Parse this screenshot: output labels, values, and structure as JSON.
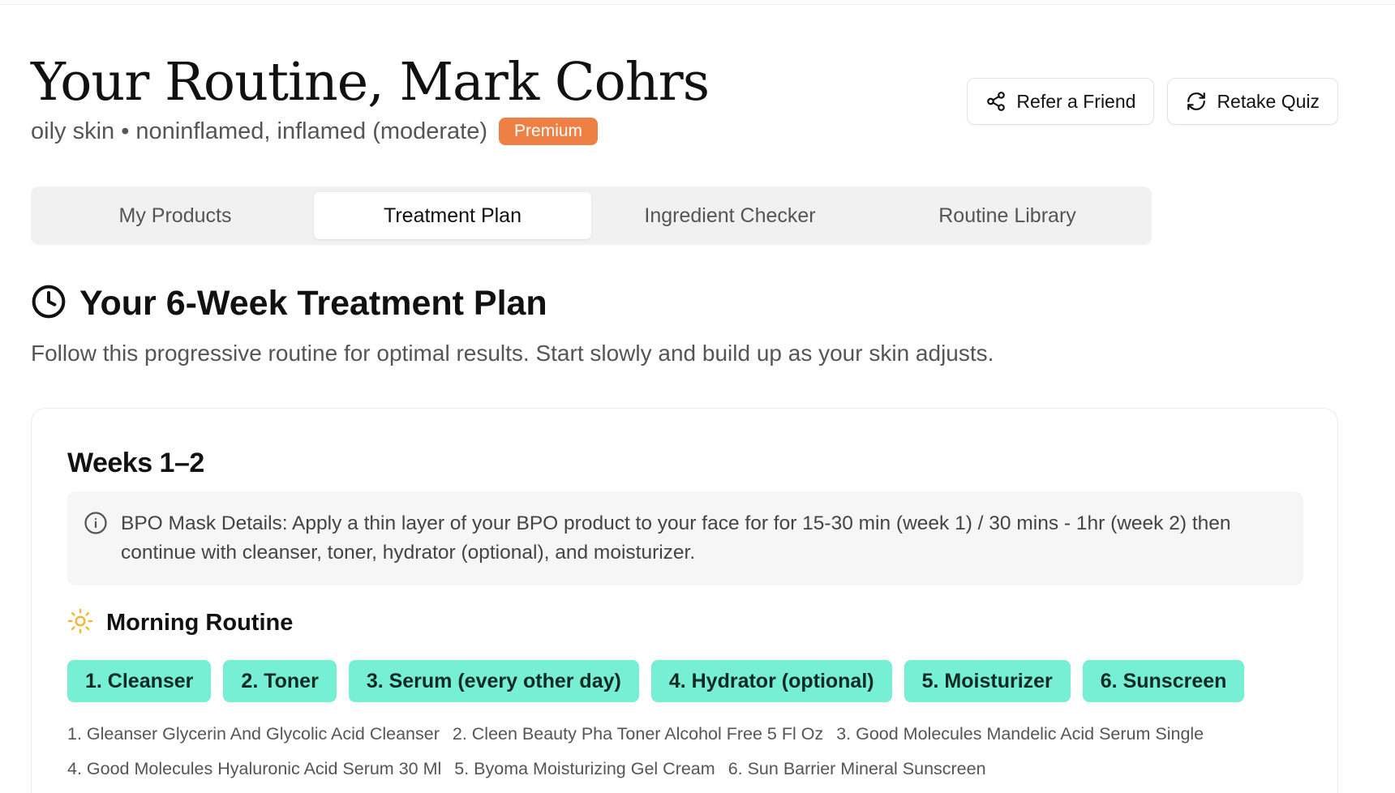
{
  "header": {
    "title": "Your Routine, Mark Cohrs",
    "subtitle": "oily skin • noninflamed, inflamed (moderate)",
    "badge": "Premium",
    "actions": {
      "refer_label": "Refer a Friend",
      "refer_icon": "share-icon",
      "retake_label": "Retake Quiz",
      "retake_icon": "refresh-icon"
    }
  },
  "tabs": [
    {
      "label": "My Products",
      "active": false
    },
    {
      "label": "Treatment Plan",
      "active": true
    },
    {
      "label": "Ingredient Checker",
      "active": false
    },
    {
      "label": "Routine Library",
      "active": false
    }
  ],
  "section": {
    "icon": "clock-icon",
    "title": "Your 6-Week Treatment Plan",
    "description": "Follow this progressive routine for optimal results. Start slowly and build up as your skin adjusts."
  },
  "plan_card": {
    "title": "Weeks 1–2",
    "notice_icon": "info-icon",
    "notice": "BPO Mask Details: Apply a thin layer of your BPO product to your face for for 15-30 min (week 1) / 30 mins - 1hr (week 2) then continue with cleanser, toner, hydrator (optional), and moisturizer.",
    "morning": {
      "icon": "sun-icon",
      "title": "Morning Routine",
      "steps": [
        "1. Cleanser",
        "2. Toner",
        "3. Serum (every other day)",
        "4. Hydrator (optional)",
        "5. Moisturizer",
        "6. Sunscreen"
      ],
      "products": [
        "1. Gleanser Glycerin And Glycolic Acid Cleanser",
        "2. Cleen Beauty Pha Toner Alcohol Free 5 Fl Oz",
        "3. Good Molecules Mandelic Acid Serum Single",
        "4. Good Molecules Hyaluronic Acid Serum 30 Ml",
        "5. Byoma Moisturizing Gel Cream",
        "6. Sun Barrier Mineral Sunscreen"
      ]
    }
  },
  "colors": {
    "accent_badge": "#ef8045",
    "chip_bg": "#76efd4",
    "sun_icon": "#f2b632"
  }
}
